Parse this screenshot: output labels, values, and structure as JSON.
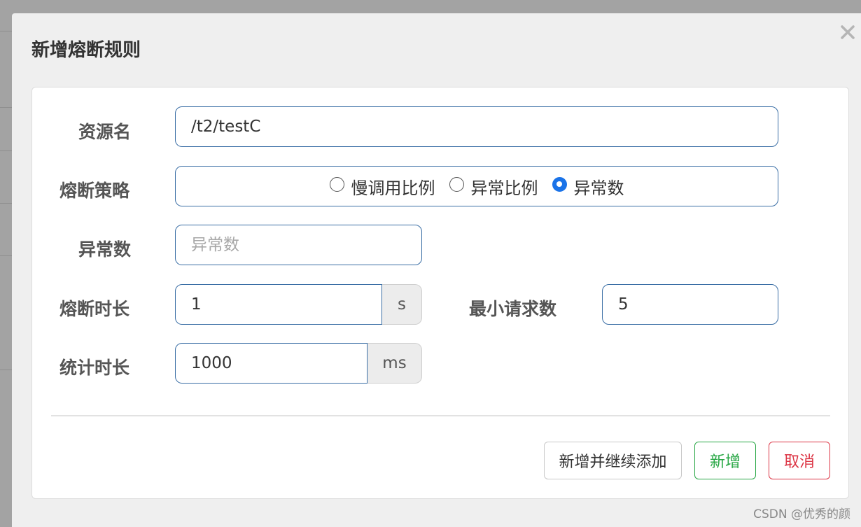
{
  "modal": {
    "title": "新增熔断规则"
  },
  "form": {
    "resource_name": {
      "label": "资源名",
      "value": "/t2/testC"
    },
    "strategy": {
      "label": "熔断策略",
      "options": [
        {
          "label": "慢调用比例",
          "checked": false
        },
        {
          "label": "异常比例",
          "checked": false
        },
        {
          "label": "异常数",
          "checked": true
        }
      ]
    },
    "exception_count": {
      "label": "异常数",
      "placeholder": "异常数",
      "value": ""
    },
    "break_duration": {
      "label": "熔断时长",
      "value": "1",
      "unit": "s"
    },
    "min_request": {
      "label": "最小请求数",
      "value": "5"
    },
    "stat_duration": {
      "label": "统计时长",
      "value": "1000",
      "unit": "ms"
    }
  },
  "footer": {
    "add_continue_label": "新增并继续添加",
    "add_label": "新增",
    "cancel_label": "取消"
  },
  "watermark": "CSDN @优秀的颜",
  "colors": {
    "primary_border": "#3a6ea5",
    "radio_checked": "#1a73e8",
    "success": "#28a745",
    "danger": "#dc3545"
  }
}
